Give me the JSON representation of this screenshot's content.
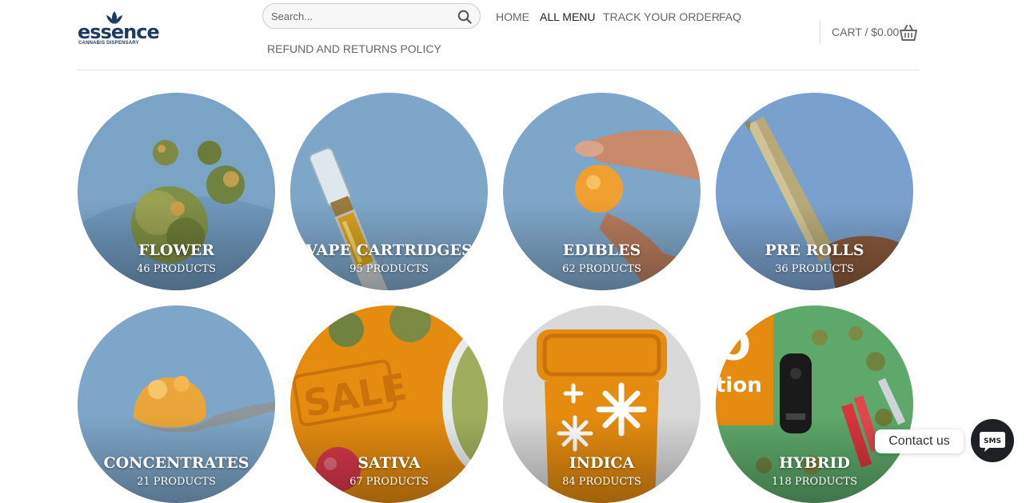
{
  "logo": {
    "word": "essence",
    "sub": "CANNABIS DISPENSARY"
  },
  "search": {
    "placeholder": "Search..."
  },
  "nav": [
    {
      "label": "HOME"
    },
    {
      "label": "ALL MENU"
    },
    {
      "label": "TRACK YOUR ORDER"
    },
    {
      "label": "FAQ"
    },
    {
      "label": "REFUND AND RETURNS POLICY"
    }
  ],
  "cart": {
    "label": "CART / $0.00"
  },
  "categories": [
    {
      "title": "FLOWER",
      "count": "46 PRODUCTS"
    },
    {
      "title": "VAPE CARTRIDGES",
      "count": "95 PRODUCTS"
    },
    {
      "title": "EDIBLES",
      "count": "62 PRODUCTS"
    },
    {
      "title": "PRE ROLLS",
      "count": "36 PRODUCTS"
    },
    {
      "title": "CONCENTRATES",
      "count": "21 PRODUCTS"
    },
    {
      "title": "SATIVA",
      "count": "67 PRODUCTS"
    },
    {
      "title": "INDICA",
      "count": "84 PRODUCTS"
    },
    {
      "title": "HYBRID",
      "count": "118 PRODUCTS"
    }
  ],
  "image_text": {
    "sale": "SALE",
    "promo": "tion"
  },
  "contact": {
    "label": "Contact us",
    "sms": "SMS"
  },
  "colors": {
    "brand": "#1f3a5f",
    "sky": "#7fa7ca",
    "orange": "#e58c10",
    "green": "#5da86a"
  }
}
